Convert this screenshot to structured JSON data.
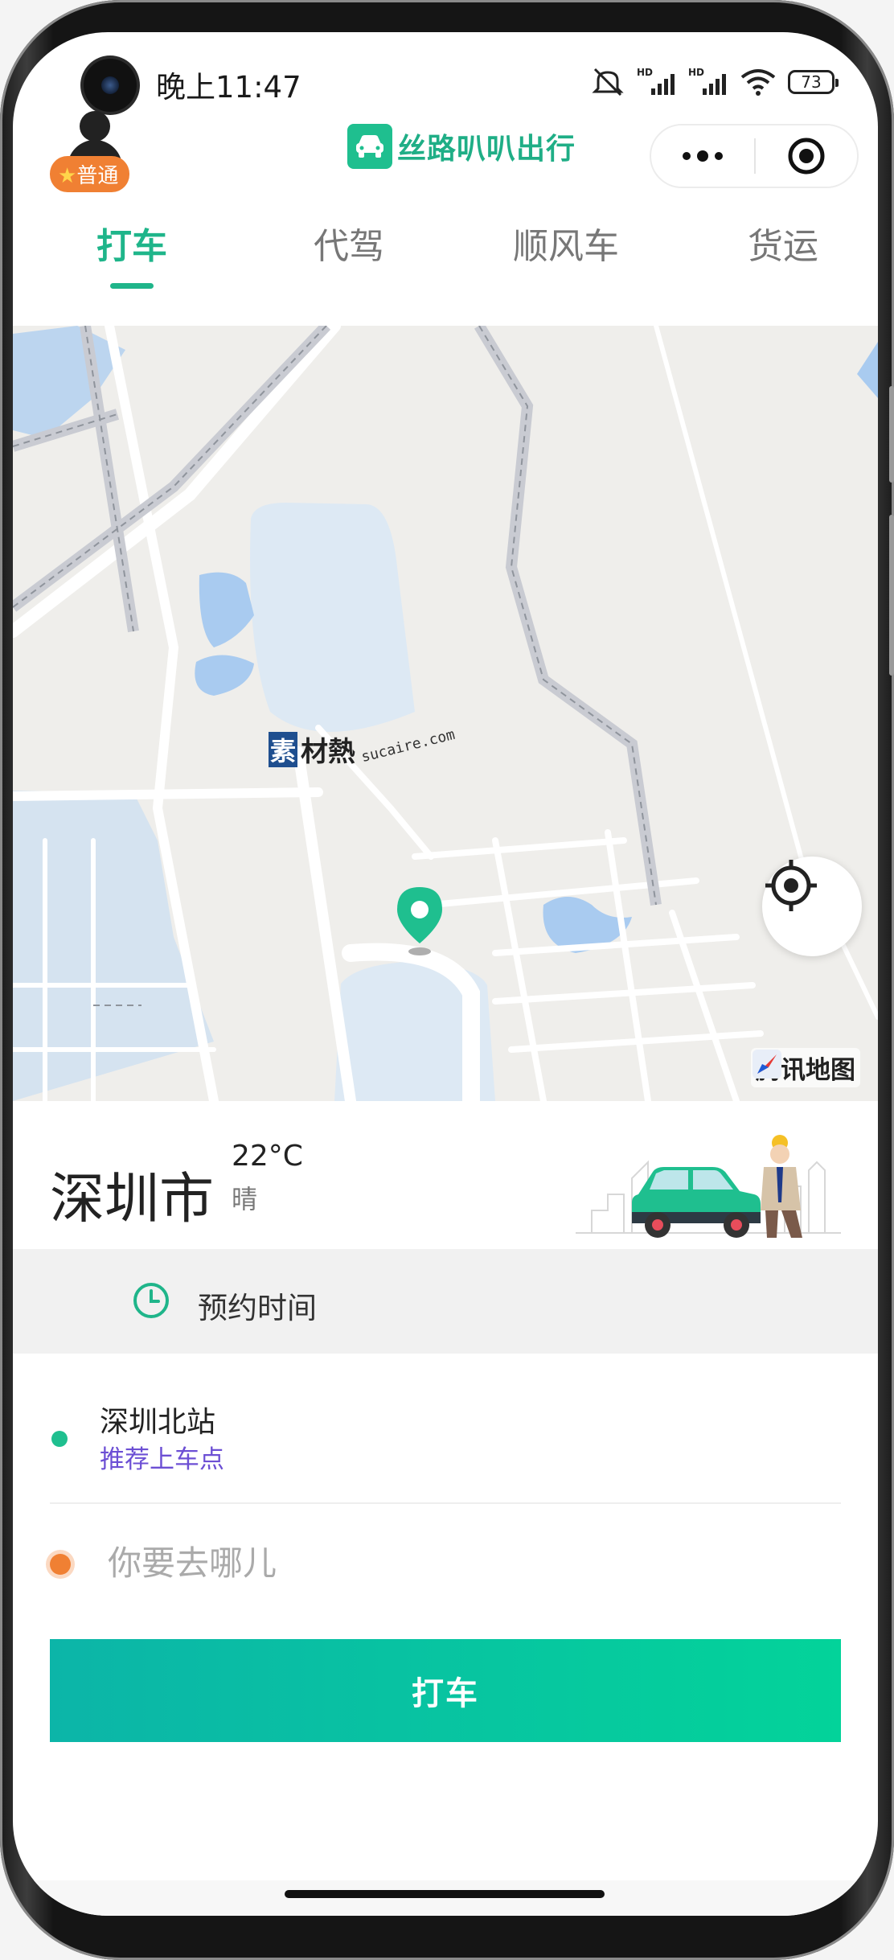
{
  "status": {
    "time": "晚上11:47",
    "battery": "73"
  },
  "header": {
    "user_badge": "普通",
    "app_name": "丝路叭叭出行"
  },
  "tabs": [
    {
      "label": "打车",
      "active": true
    },
    {
      "label": "代驾",
      "active": false
    },
    {
      "label": "顺风车",
      "active": false
    },
    {
      "label": "货运",
      "active": false
    }
  ],
  "map": {
    "watermark_text": "材熱",
    "watermark_box": "素",
    "watermark_url": "sucaire.com",
    "brand": "腾讯地图"
  },
  "location": {
    "city": "深圳市",
    "temperature": "22°C",
    "weather": "晴"
  },
  "reservation": {
    "label": "预约时间"
  },
  "pickup": {
    "name": "深圳北站",
    "hint": "推荐上车点"
  },
  "destination": {
    "placeholder": "你要去哪儿"
  },
  "action": {
    "call_label": "打车"
  },
  "colors": {
    "accent": "#1fb58a",
    "badge": "#f08033",
    "hint": "#6c4fd4"
  },
  "icons": [
    "star-icon",
    "car-icon",
    "more-dots-icon",
    "close-target-icon",
    "location-pin-icon",
    "locate-icon",
    "clock-icon",
    "tencent-map-logo-icon"
  ]
}
